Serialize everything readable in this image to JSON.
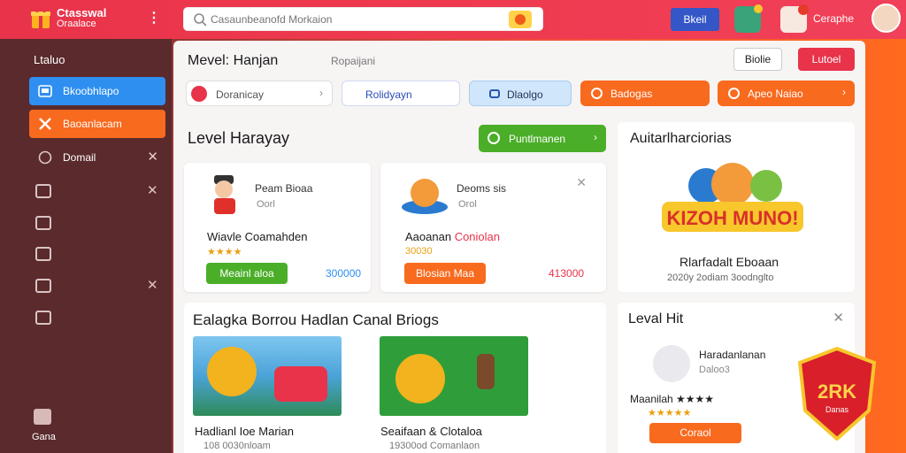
{
  "header": {
    "brand_line1": "Ctasswal",
    "brand_line2": "Oraalace",
    "search_placeholder": "Casaunbeanofd Morkaion",
    "button_blue": "Bkeil",
    "username": "Ceraphe"
  },
  "sidebar": {
    "title": "Ltaluo",
    "items": [
      {
        "label": "Bkoobhlapo",
        "icon": "image-icon"
      },
      {
        "label": "Baoanlacam",
        "icon": "close-icon"
      },
      {
        "label": "Domail",
        "icon": "chat-icon"
      }
    ],
    "bottom_label": "Gana"
  },
  "main": {
    "title": "Mevel: Hanjan",
    "subtitle": "Ropaijani",
    "btn_white": "Biolie",
    "btn_red": "Lutoel"
  },
  "filters": [
    "Doranicay",
    "Rolidyayn",
    "Dlaolgo",
    "Badogas",
    "Apeo Naiao"
  ],
  "section": {
    "title": "Level Harayay",
    "cta": "Puntlmanen"
  },
  "cards": [
    {
      "name": "Peam Bioaa",
      "meta": "Oorl",
      "title": "Wiavle Coamahden",
      "stars": "★★★★",
      "button": "Meainl aloa",
      "price": "300000"
    },
    {
      "name": "Deoms sis",
      "meta": "Orol",
      "title_a": "Aaoanan",
      "title_b": "Coniolan",
      "stars": "30030",
      "button": "Blosian Maa",
      "price": "413000"
    }
  ],
  "side_panel": {
    "title": "Auitarlharciorias",
    "art_text": "KIZOH MUNO!",
    "name": "Rlarfadalt Eboaan",
    "meta": "2020y 2odiam 3oodnglto"
  },
  "panel2": {
    "title": "Ealagka Borrou Hadlan Canal Briogs",
    "items": [
      {
        "caption": "Hadlianl Ioe Marian",
        "meta": "108 0030nloam"
      },
      {
        "caption": "Seaifaan & Clotaloa",
        "meta": "19300od Comanlaon"
      }
    ]
  },
  "panel3": {
    "title": "Leval Hit",
    "name": "Haradanlanan",
    "meta": "Daloo3",
    "row": "Maanilah ★★★★",
    "stars": "★★★★★",
    "button": "Coraol"
  },
  "promo": {
    "text": "2RK",
    "sub": "Danas"
  },
  "colors": {
    "accent": "#e8334a",
    "orange": "#f86a1e",
    "green": "#4aae28",
    "blue": "#2f8ff0"
  }
}
